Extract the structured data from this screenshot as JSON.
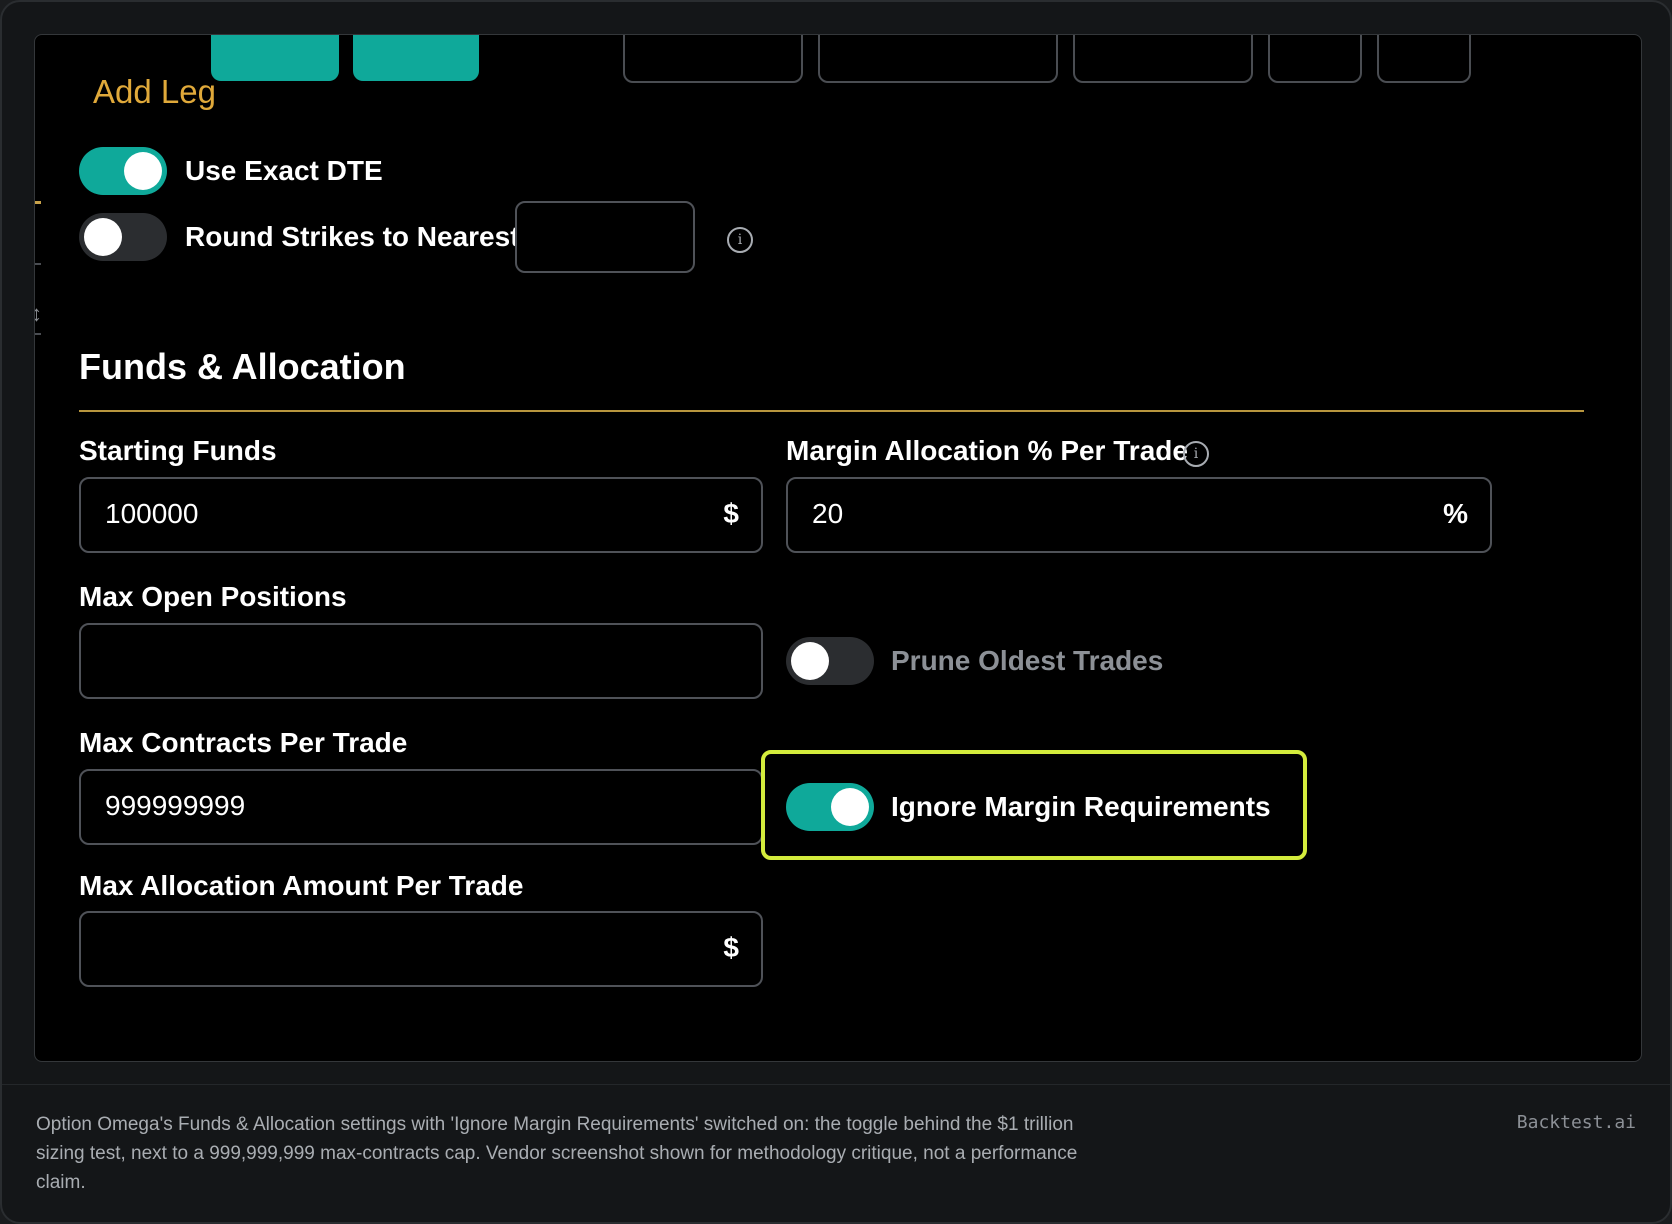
{
  "form": {
    "add_leg_label": "Add Leg",
    "use_exact_dte": {
      "label": "Use Exact DTE",
      "enabled": true
    },
    "round_strikes": {
      "label": "Round Strikes to Nearest",
      "enabled": false,
      "value": ""
    }
  },
  "section": {
    "title": "Funds & Allocation",
    "starting_funds": {
      "label": "Starting Funds",
      "value": "100000",
      "unit": "$"
    },
    "margin_allocation": {
      "label": "Margin Allocation % Per Trade",
      "value": "20",
      "unit": "%"
    },
    "max_open_positions": {
      "label": "Max Open Positions",
      "value": ""
    },
    "prune_oldest_trades": {
      "label": "Prune Oldest Trades",
      "enabled": false
    },
    "max_contracts": {
      "label": "Max Contracts Per Trade",
      "value": "999999999"
    },
    "ignore_margin": {
      "label": "Ignore Margin Requirements",
      "enabled": true
    },
    "max_allocation_amount": {
      "label": "Max Allocation Amount Per Trade",
      "value": "",
      "unit": "$"
    }
  },
  "footer": {
    "caption": "Option Omega's Funds & Allocation settings with 'Ignore Margin Requirements' switched on: the toggle behind the $1 trillion sizing test, next to a 999,999,999 max-contracts cap. Vendor screenshot shown for methodology critique, not a performance claim.",
    "brand": "Backtest.ai"
  },
  "colors": {
    "accent_teal": "#0fa99a",
    "accent_gold": "#e0a93a",
    "highlight": "#d4ec3c"
  },
  "icons": [
    "info-icon",
    "chevron-updown-icon"
  ]
}
